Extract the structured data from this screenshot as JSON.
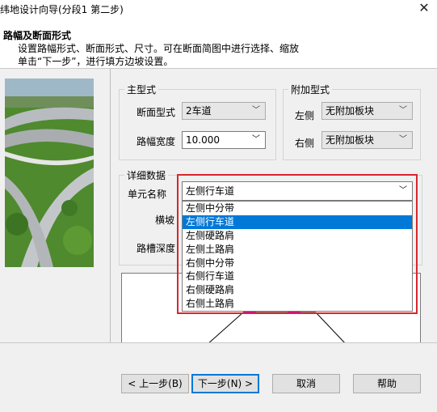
{
  "window": {
    "title": "纬地设计向导(分段1 第二步)",
    "close_glyph": "✕"
  },
  "header": {
    "title": "路幅及断面形式",
    "desc_line1": "设置路幅形式、断面形式、尺寸。可在断面简图中进行选择、缩放",
    "desc_line2": "单击“下一步”，进行填方边坡设置。"
  },
  "main_type": {
    "group_label": "主型式",
    "section_type_label": "断面型式",
    "section_type_value": "2车道",
    "road_width_label": "路幅宽度",
    "road_width_value": "10.000"
  },
  "attached_type": {
    "group_label": "附加型式",
    "left_label": "左侧",
    "left_value": "无附加板块",
    "right_label": "右侧",
    "right_value": "无附加板块"
  },
  "detail": {
    "group_label": "详细数据",
    "unit_name_label": "单元名称",
    "unit_name_value": "左侧行车道",
    "slope_label": "横坡",
    "trough_depth_label": "路槽深度",
    "dropdown_options": [
      "左侧中分带",
      "左侧行车道",
      "左侧硬路肩",
      "左侧土路肩",
      "右侧中分带",
      "右侧行车道",
      "右侧硬路肩",
      "右侧土路肩"
    ],
    "selected_index": 1
  },
  "footer": {
    "prev_label": "< 上一步(B)",
    "next_label": "下一步(N) >",
    "cancel_label": "取消",
    "help_label": "帮助"
  },
  "colors": {
    "highlight": "#d9262c",
    "selection": "#0078d7",
    "marker": "#c800c8"
  }
}
